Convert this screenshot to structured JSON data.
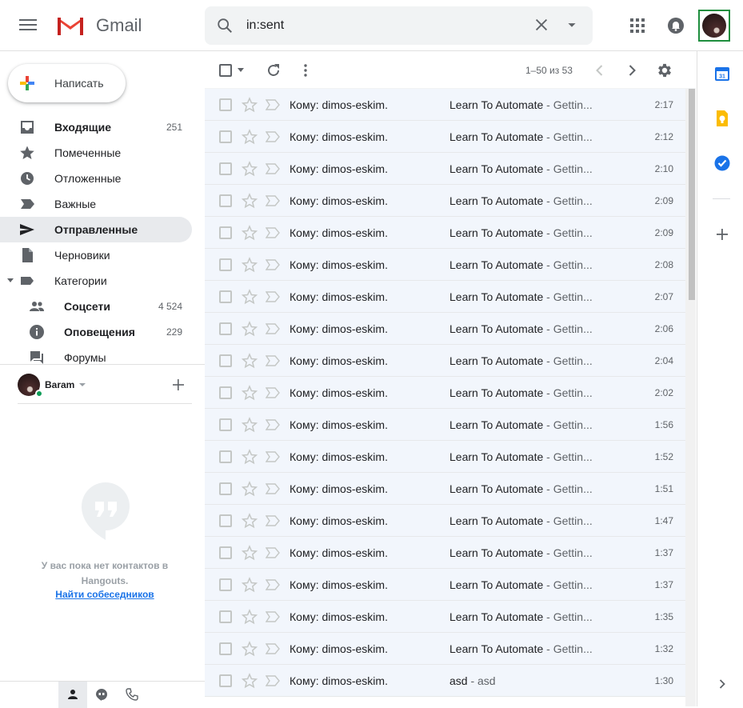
{
  "header": {
    "brand": "Gmail",
    "search_value": "in:sent"
  },
  "compose_label": "Написать",
  "nav": [
    {
      "label": "Входящие",
      "count": "251"
    },
    {
      "label": "Помеченные",
      "count": ""
    },
    {
      "label": "Отложенные",
      "count": ""
    },
    {
      "label": "Важные",
      "count": ""
    },
    {
      "label": "Отправленные",
      "count": ""
    },
    {
      "label": "Черновики",
      "count": ""
    },
    {
      "label": "Категории",
      "count": ""
    },
    {
      "label": "Соцсети",
      "count": "4 524"
    },
    {
      "label": "Оповещения",
      "count": "229"
    },
    {
      "label": "Форумы",
      "count": ""
    }
  ],
  "hangouts": {
    "user": "Baram",
    "empty_line": "У вас пока нет контактов в Hangouts.",
    "find_link": "Найти собеседников"
  },
  "toolbar": {
    "range": "1–50 из 53"
  },
  "messages": [
    {
      "to": "Кому: dimos-eskim.",
      "subject": "Learn To Automate",
      "snippet": " - Gettin...",
      "time": "2:17"
    },
    {
      "to": "Кому: dimos-eskim.",
      "subject": "Learn To Automate",
      "snippet": " - Gettin...",
      "time": "2:12"
    },
    {
      "to": "Кому: dimos-eskim.",
      "subject": "Learn To Automate",
      "snippet": " - Gettin...",
      "time": "2:10"
    },
    {
      "to": "Кому: dimos-eskim.",
      "subject": "Learn To Automate",
      "snippet": " - Gettin...",
      "time": "2:09"
    },
    {
      "to": "Кому: dimos-eskim.",
      "subject": "Learn To Automate",
      "snippet": " - Gettin...",
      "time": "2:09"
    },
    {
      "to": "Кому: dimos-eskim.",
      "subject": "Learn To Automate",
      "snippet": " - Gettin...",
      "time": "2:08"
    },
    {
      "to": "Кому: dimos-eskim.",
      "subject": "Learn To Automate",
      "snippet": " - Gettin...",
      "time": "2:07"
    },
    {
      "to": "Кому: dimos-eskim.",
      "subject": "Learn To Automate",
      "snippet": " - Gettin...",
      "time": "2:06"
    },
    {
      "to": "Кому: dimos-eskim.",
      "subject": "Learn To Automate",
      "snippet": " - Gettin...",
      "time": "2:04"
    },
    {
      "to": "Кому: dimos-eskim.",
      "subject": "Learn To Automate",
      "snippet": " - Gettin...",
      "time": "2:02"
    },
    {
      "to": "Кому: dimos-eskim.",
      "subject": "Learn To Automate",
      "snippet": " - Gettin...",
      "time": "1:56"
    },
    {
      "to": "Кому: dimos-eskim.",
      "subject": "Learn To Automate",
      "snippet": " - Gettin...",
      "time": "1:52"
    },
    {
      "to": "Кому: dimos-eskim.",
      "subject": "Learn To Automate",
      "snippet": " - Gettin...",
      "time": "1:51"
    },
    {
      "to": "Кому: dimos-eskim.",
      "subject": "Learn To Automate",
      "snippet": " - Gettin...",
      "time": "1:47"
    },
    {
      "to": "Кому: dimos-eskim.",
      "subject": "Learn To Automate",
      "snippet": " - Gettin...",
      "time": "1:37"
    },
    {
      "to": "Кому: dimos-eskim.",
      "subject": "Learn To Automate",
      "snippet": " - Gettin...",
      "time": "1:37"
    },
    {
      "to": "Кому: dimos-eskim.",
      "subject": "Learn To Automate",
      "snippet": " - Gettin...",
      "time": "1:35"
    },
    {
      "to": "Кому: dimos-eskim.",
      "subject": "Learn To Automate",
      "snippet": " - Gettin...",
      "time": "1:32"
    },
    {
      "to": "Кому: dimos-eskim.",
      "subject": "asd",
      "snippet": " - asd",
      "time": "1:30"
    }
  ],
  "colors": {
    "accent_red": "#ea4335",
    "active_bg": "#e8eaed",
    "row_bg": "#f2f6fc",
    "link_blue": "#1a73e8",
    "online_green": "#0f9d58"
  },
  "icons": [
    "menu-icon",
    "gmail-logo",
    "search-icon",
    "close-icon",
    "dropdown-icon",
    "apps-icon",
    "notifications-icon",
    "refresh-icon",
    "more-icon",
    "settings-icon",
    "calendar-icon",
    "keep-icon",
    "tasks-icon",
    "add-icon"
  ]
}
